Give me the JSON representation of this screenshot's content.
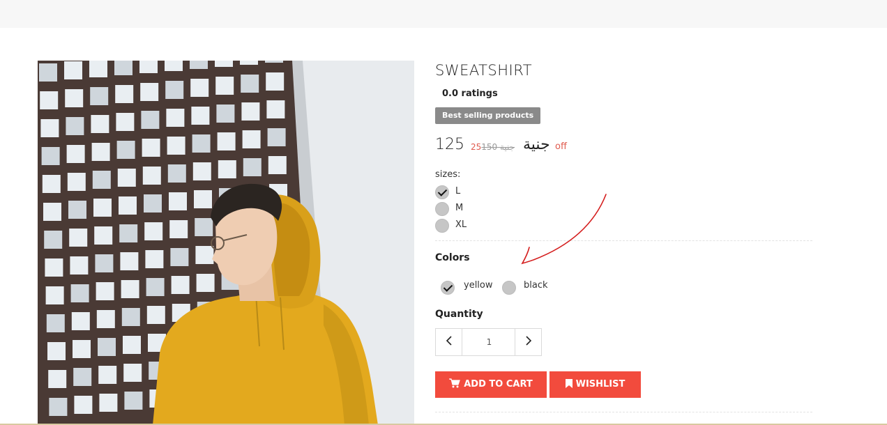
{
  "product": {
    "title": "SWEATSHIRT",
    "rating_text": "0.0 ratings",
    "badge": "Best selling products",
    "price": {
      "current": "125",
      "discount": "25",
      "old": "150 جنية",
      "currency": "جنية",
      "off_label": "off"
    },
    "sizes": {
      "label": "sizes:",
      "options": [
        {
          "label": "L",
          "checked": true
        },
        {
          "label": "M",
          "checked": false
        },
        {
          "label": "XL",
          "checked": false
        }
      ]
    },
    "colors": {
      "label": "Colors",
      "options": [
        {
          "label": "yellow",
          "checked": true
        },
        {
          "label": "black",
          "checked": false
        }
      ]
    },
    "quantity": {
      "label": "Quantity",
      "value": "1",
      "decrement_icon": "chevron-left-icon",
      "increment_icon": "chevron-right-icon"
    },
    "actions": {
      "add_to_cart": "ADD TO CART",
      "wishlist": "WISHLIST"
    }
  },
  "colors": {
    "accent": "#f24b3d",
    "price_red": "#e05a4e",
    "badge_bg": "#8a8a8a",
    "annotation": "#d41c1c"
  },
  "image": {
    "description_icon": "product-photo"
  }
}
